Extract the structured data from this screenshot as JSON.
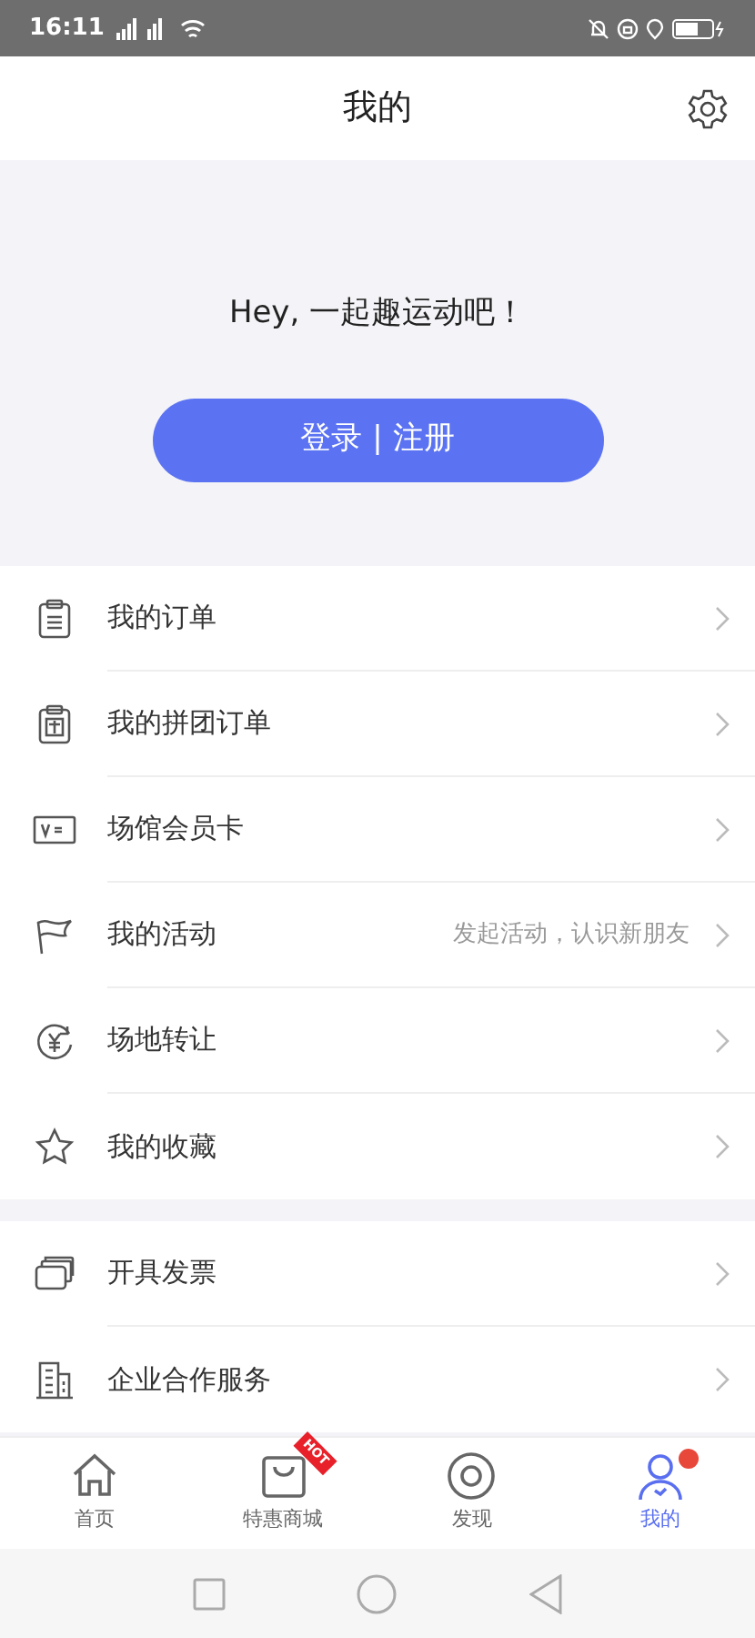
{
  "status_bar": {
    "time": "16:11"
  },
  "header": {
    "title": "我的"
  },
  "hero": {
    "greeting": "Hey, 一起趣运动吧！",
    "login_button": "登录 | 注册"
  },
  "menu_groups": [
    {
      "items": [
        {
          "kind": "order",
          "label": "我的订单"
        },
        {
          "kind": "group-order",
          "label": "我的拼团订单"
        },
        {
          "kind": "card",
          "label": "场馆会员卡"
        },
        {
          "kind": "flag",
          "label": "我的活动",
          "hint": "发起活动，认识新朋友"
        },
        {
          "kind": "transfer",
          "label": "场地转让"
        },
        {
          "kind": "star",
          "label": "我的收藏"
        }
      ]
    },
    {
      "items": [
        {
          "kind": "invoice",
          "label": "开具发票"
        },
        {
          "kind": "building",
          "label": "企业合作服务"
        }
      ]
    }
  ],
  "tab_bar": [
    {
      "kind": "home",
      "label": "首页",
      "selected": false
    },
    {
      "kind": "shop",
      "label": "特惠商城",
      "selected": false,
      "badge": "HOT"
    },
    {
      "kind": "discover",
      "label": "发现",
      "selected": false
    },
    {
      "kind": "profile",
      "label": "我的",
      "selected": true,
      "dot": true
    }
  ]
}
